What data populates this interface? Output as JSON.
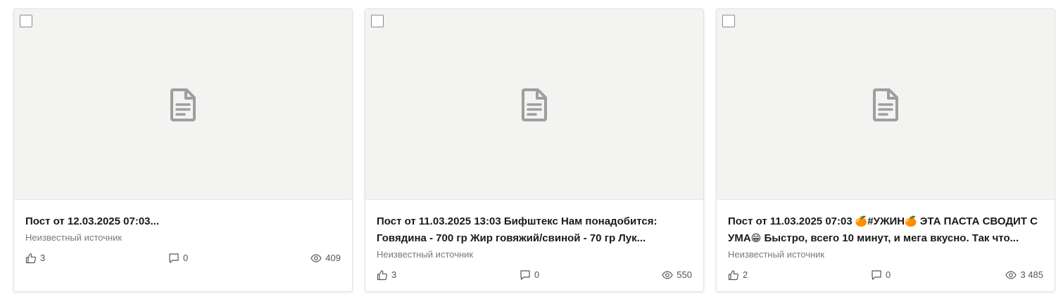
{
  "cards": [
    {
      "title": "Пост от 12.03.2025 07:03...",
      "source": "Неизвестный источник",
      "likes": "3",
      "comments": "0",
      "views": "409"
    },
    {
      "title": "Пост от 11.03.2025 13:03 Бифштекс Нам понадобится: Говядина - 700 гр Жир говяжий/свиной - 70 гр Лук...",
      "source": "Неизвестный источник",
      "likes": "3",
      "comments": "0",
      "views": "550"
    },
    {
      "title_part1": "Пост от 11.03.2025 07:03 ",
      "emoji_tangerine": "🍊",
      "title_part2": "#УЖИН",
      "title_part3": " ЭТА ПАСТА СВОДИТ С УМА",
      "emoji_grin": "😁",
      "title_part4": " Быстро, всего 10 минут, и мега вкусно. Так что...",
      "source": "Неизвестный источник",
      "likes": "2",
      "comments": "0",
      "views": "3 485"
    }
  ],
  "icons": {
    "placeholder": "document-icon",
    "likes": "thumbs-up-icon",
    "comments": "comment-icon",
    "views": "eye-icon"
  },
  "colors": {
    "preview_bg": "#f3f3f2",
    "doc_icon": "#9e9e9e",
    "title": "#1a1a1a",
    "muted": "#7a7a7a"
  }
}
